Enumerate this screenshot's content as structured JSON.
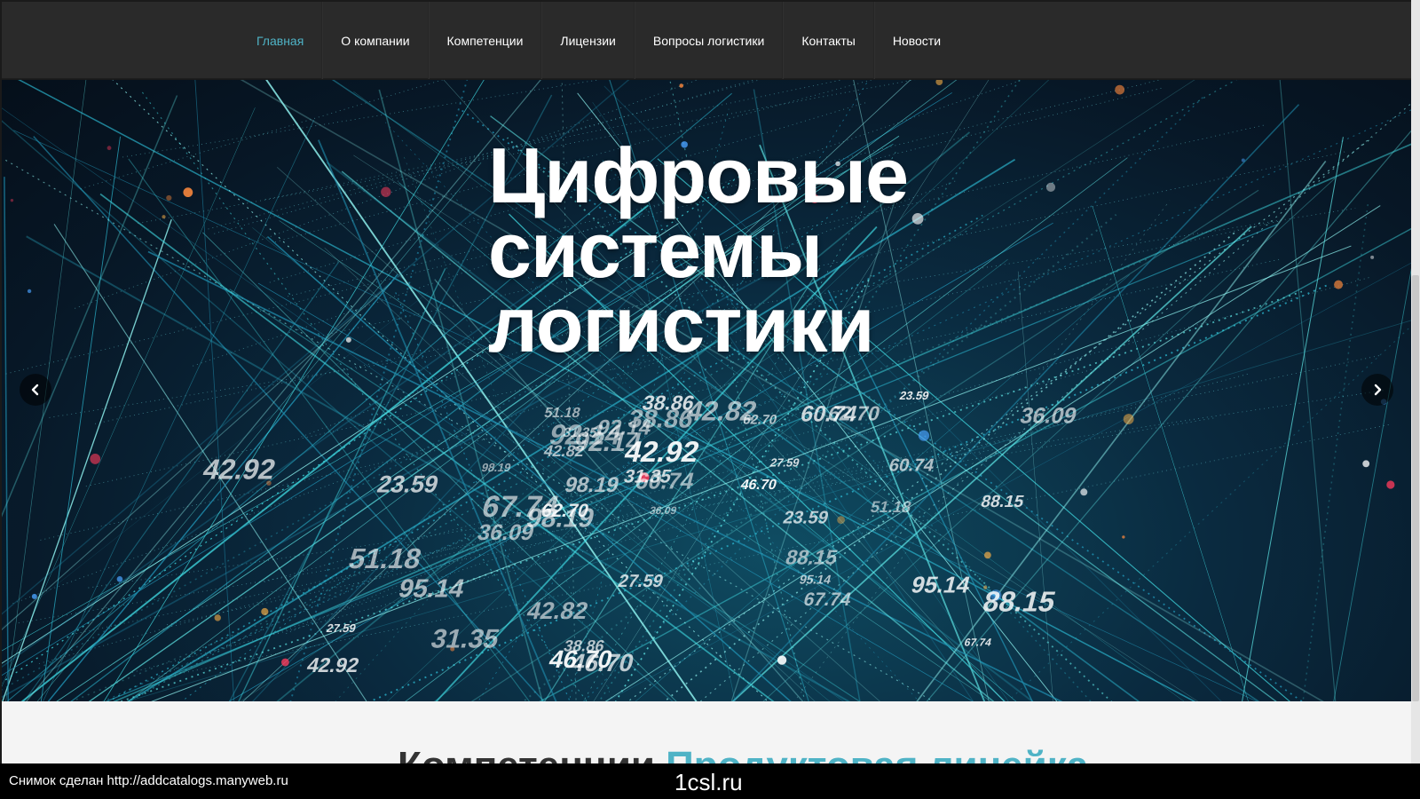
{
  "nav": {
    "items": [
      {
        "label": "Главная",
        "active": true
      },
      {
        "label": "О компании",
        "active": false
      },
      {
        "label": "Компетенции",
        "active": false
      },
      {
        "label": "Лицензии",
        "active": false
      },
      {
        "label": "Вопросы логистики",
        "active": false
      },
      {
        "label": "Контакты",
        "active": false
      },
      {
        "label": "Новости",
        "active": false
      }
    ],
    "active_color": "#4fb3c6"
  },
  "hero": {
    "title_lines": [
      "Цифровые",
      "системы",
      "логистики"
    ],
    "prev_icon": "chevron-left-icon",
    "next_icon": "chevron-right-icon",
    "background_numbers": [
      "95.14",
      "23.59",
      "36.09",
      "31.35",
      "42.92",
      "88.15",
      "98.19",
      "42.82",
      "67.74",
      "38.86",
      "92.14",
      "62.70",
      "46.70",
      "60.74",
      "27.59",
      "51.18"
    ]
  },
  "section": {
    "heading_main": "Компетенции",
    "heading_accent": "Продуктовая линейка"
  },
  "footer": {
    "caption": "Снимок сделан http://addcatalogs.manyweb.ru",
    "site": "1csl.ru"
  }
}
